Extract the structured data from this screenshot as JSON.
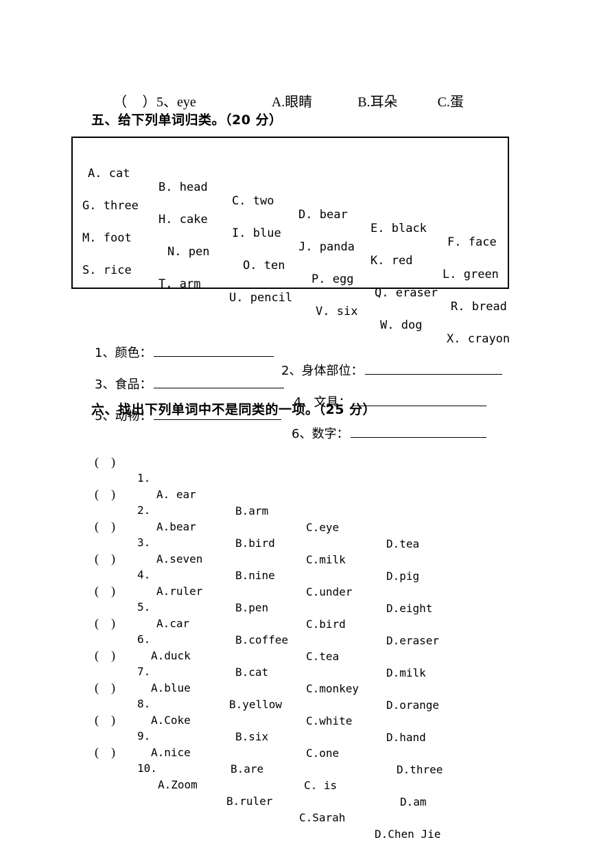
{
  "document": {
    "type": "primary-school-english-exam",
    "language": "zh-CN-en"
  },
  "previous_question": {
    "paren": "（    ）",
    "number": "5、",
    "stem": "eye",
    "options": [
      {
        "label": "A.",
        "text": "眼睛"
      },
      {
        "label": "B.",
        "text": "耳朵"
      },
      {
        "label": "C.",
        "text": "蛋"
      }
    ]
  },
  "section_five": {
    "heading": "五、给下列单词归类。（20 分）",
    "word_bank": {
      "rows": [
        [
          {
            "letter": "A.",
            "word": "cat"
          },
          {
            "letter": "B.",
            "word": "head"
          },
          {
            "letter": "C.",
            "word": "two"
          },
          {
            "letter": "D.",
            "word": "bear"
          },
          {
            "letter": "E.",
            "word": "black"
          },
          {
            "letter": "F.",
            "word": "face"
          }
        ],
        [
          {
            "letter": "G.",
            "word": "three"
          },
          {
            "letter": "H.",
            "word": "cake"
          },
          {
            "letter": "I.",
            "word": "blue"
          },
          {
            "letter": "J.",
            "word": "panda"
          },
          {
            "letter": "K.",
            "word": "red"
          },
          {
            "letter": "L.",
            "word": "green"
          }
        ],
        [
          {
            "letter": "M.",
            "word": "foot"
          },
          {
            "letter": "N.",
            "word": "pen"
          },
          {
            "letter": "O.",
            "word": "ten"
          },
          {
            "letter": "P.",
            "word": "egg"
          },
          {
            "letter": "Q.",
            "word": "eraser"
          },
          {
            "letter": "R.",
            "word": "bread"
          }
        ],
        [
          {
            "letter": "S.",
            "word": "rice"
          },
          {
            "letter": "T.",
            "word": "arm"
          },
          {
            "letter": "U.",
            "word": "pencil"
          },
          {
            "letter": "V.",
            "word": "six"
          },
          {
            "letter": "W.",
            "word": "dog"
          },
          {
            "letter": "X.",
            "word": "crayon"
          }
        ]
      ]
    },
    "categories": [
      {
        "label": "1、颜色：",
        "answer": ""
      },
      {
        "label": "2、身体部位：",
        "answer": ""
      },
      {
        "label": "3、食品：",
        "answer": ""
      },
      {
        "label": "4、文具：",
        "answer": ""
      },
      {
        "label": "5、动物：",
        "answer": ""
      },
      {
        "label": "6、数字：",
        "answer": ""
      }
    ]
  },
  "section_six": {
    "heading": "六、找出下列单词中不是同类的一项。（25 分）",
    "questions": [
      {
        "paren": "(    )",
        "number": "1.",
        "options": [
          {
            "label": "A.",
            "text": " ear"
          },
          {
            "label": "B.",
            "text": "arm"
          },
          {
            "label": "C.",
            "text": "eye"
          },
          {
            "label": "D.",
            "text": "tea"
          }
        ]
      },
      {
        "paren": "(    )",
        "number": "2.",
        "options": [
          {
            "label": "A.",
            "text": "bear"
          },
          {
            "label": "B.",
            "text": "bird"
          },
          {
            "label": "C.",
            "text": "milk"
          },
          {
            "label": "D.",
            "text": "pig"
          }
        ]
      },
      {
        "paren": "(    )",
        "number": "3.",
        "options": [
          {
            "label": "A.",
            "text": "seven"
          },
          {
            "label": "B.",
            "text": "nine"
          },
          {
            "label": "C.",
            "text": "under"
          },
          {
            "label": "D.",
            "text": "eight"
          }
        ]
      },
      {
        "paren": "(    )",
        "number": "4.",
        "options": [
          {
            "label": "A.",
            "text": "ruler"
          },
          {
            "label": "B.",
            "text": "pen"
          },
          {
            "label": "C.",
            "text": "bird"
          },
          {
            "label": "D.",
            "text": "eraser"
          }
        ]
      },
      {
        "paren": "(    )",
        "number": "5.",
        "options": [
          {
            "label": "A.",
            "text": "car"
          },
          {
            "label": "B.",
            "text": "coffee"
          },
          {
            "label": "C.",
            "text": "tea"
          },
          {
            "label": "D.",
            "text": "milk"
          }
        ]
      },
      {
        "paren": "(    )",
        "number": "6.",
        "options": [
          {
            "label": "A.",
            "text": "duck"
          },
          {
            "label": "B.",
            "text": "cat"
          },
          {
            "label": "C.",
            "text": "monkey"
          },
          {
            "label": "D.",
            "text": "orange"
          }
        ]
      },
      {
        "paren": "(    )",
        "number": "7.",
        "options": [
          {
            "label": "A.",
            "text": "blue"
          },
          {
            "label": "B.",
            "text": "yellow"
          },
          {
            "label": "C.",
            "text": "white"
          },
          {
            "label": "D.",
            "text": "hand"
          }
        ]
      },
      {
        "paren": "(    )",
        "number": "8.",
        "options": [
          {
            "label": "A.",
            "text": "Coke"
          },
          {
            "label": "B.",
            "text": "six"
          },
          {
            "label": "C.",
            "text": "one"
          },
          {
            "label": "D.",
            "text": "three"
          }
        ]
      },
      {
        "paren": "(    )",
        "number": "9.",
        "options": [
          {
            "label": "A.",
            "text": "nice"
          },
          {
            "label": "B.",
            "text": "are"
          },
          {
            "label": "C.",
            "text": " is"
          },
          {
            "label": "D.",
            "text": "am"
          }
        ]
      },
      {
        "paren": "(    )",
        "number": "10.",
        "options": [
          {
            "label": "A.",
            "text": "Zoom"
          },
          {
            "label": "B.",
            "text": "ruler"
          },
          {
            "label": "C.",
            "text": "Sarah"
          },
          {
            "label": "D.",
            "text": "Chen Jie"
          }
        ]
      }
    ]
  }
}
